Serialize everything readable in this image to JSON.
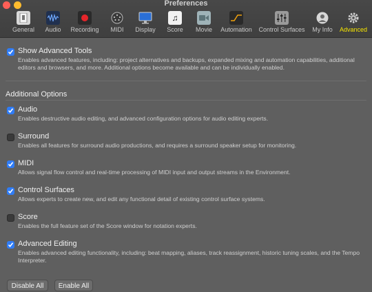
{
  "window": {
    "title": "Preferences"
  },
  "toolbar": {
    "items": [
      {
        "label": "General",
        "icon": "general-icon"
      },
      {
        "label": "Audio",
        "icon": "audio-icon"
      },
      {
        "label": "Recording",
        "icon": "record-icon"
      },
      {
        "label": "MIDI",
        "icon": "midi-icon"
      },
      {
        "label": "Display",
        "icon": "display-icon"
      },
      {
        "label": "Score",
        "icon": "score-icon"
      },
      {
        "label": "Movie",
        "icon": "movie-icon"
      },
      {
        "label": "Automation",
        "icon": "automation-icon"
      },
      {
        "label": "Control Surfaces",
        "icon": "control-surfaces-icon"
      },
      {
        "label": "My Info",
        "icon": "my-info-icon"
      },
      {
        "label": "Advanced",
        "icon": "gear-icon",
        "selected": true
      }
    ],
    "active_label_color": "#f7e600"
  },
  "main": {
    "show_advanced": {
      "label": "Show Advanced Tools",
      "checked": true,
      "description": "Enables advanced features, including: project alternatives and backups, expanded mixing and automation capabilities, additional editors and browsers, and more. Additional options become available and can be individually enabled."
    },
    "additional_title": "Additional Options",
    "options": [
      {
        "label": "Audio",
        "checked": true,
        "description": "Enables destructive audio editing, and advanced configuration options for audio editing experts."
      },
      {
        "label": "Surround",
        "checked": false,
        "description": "Enables all features for surround audio productions, and requires a surround speaker setup for monitoring."
      },
      {
        "label": "MIDI",
        "checked": true,
        "description": "Allows signal flow control and real-time processing of MIDI input and output streams in the Environment."
      },
      {
        "label": "Control Surfaces",
        "checked": true,
        "description": "Allows experts to create new, and edit any functional detail of existing control surface systems."
      },
      {
        "label": "Score",
        "checked": false,
        "description": "Enables the full feature set of the Score window for notation experts."
      },
      {
        "label": "Advanced Editing",
        "checked": true,
        "description": "Enables advanced editing functionality, including: beat mapping, aliases, track reassignment, historic tuning scales, and the Tempo Interpreter."
      }
    ],
    "disable_all_label": "Disable All",
    "enable_all_label": "Enable All"
  },
  "colors": {
    "checkbox_on": "#2f7cf6",
    "background": "#5f5f5f"
  }
}
